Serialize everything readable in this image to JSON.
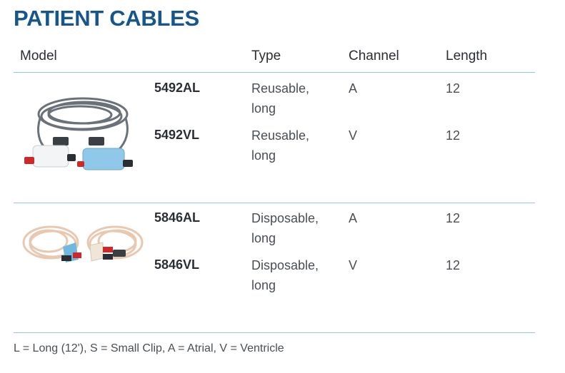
{
  "title": "PATIENT CABLES",
  "headers": {
    "model": "Model",
    "type": "Type",
    "channel": "Channel",
    "length": "Length"
  },
  "groups": [
    {
      "image": "reusable-cable-photo",
      "rows": [
        {
          "model": "5492AL",
          "type_line1": "Reusable,",
          "type_line2": "long",
          "channel": "A",
          "length": "12"
        },
        {
          "model": "5492VL",
          "type_line1": "Reusable,",
          "type_line2": "long",
          "channel": "V",
          "length": "12"
        }
      ]
    },
    {
      "image": "disposable-cable-photo",
      "rows": [
        {
          "model": "5846AL",
          "type_line1": "Disposable,",
          "type_line2": "long",
          "channel": "A",
          "length": "12"
        },
        {
          "model": "5846VL",
          "type_line1": "Disposable,",
          "type_line2": "long",
          "channel": "V",
          "length": "12"
        }
      ]
    }
  ],
  "footnote": "L = Long (12'), S = Small Clip, A = Atrial, V = Ventricle",
  "colors": {
    "title": "#17568c",
    "rule": "#8fcfcf",
    "cable_gray": "#6b7178",
    "clip_blue": "#8fc8e8",
    "lead_tan": "#e8c9b0"
  }
}
